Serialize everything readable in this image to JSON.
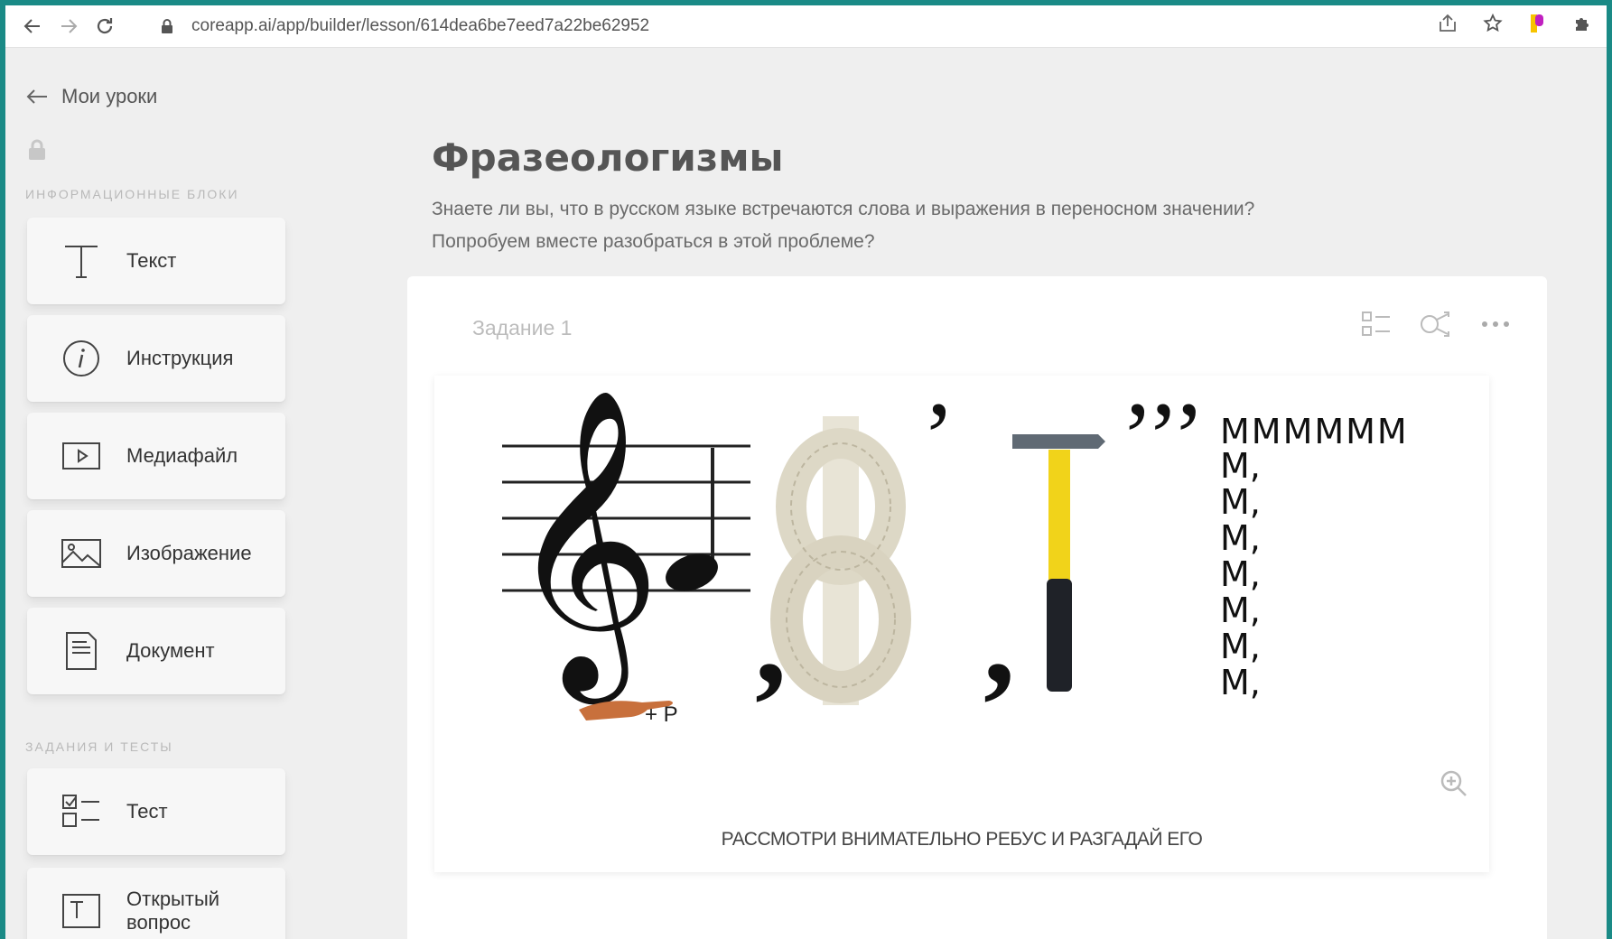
{
  "browser": {
    "url": "coreapp.ai/app/builder/lesson/614dea6be7eed7a22be62952"
  },
  "sidebar": {
    "back_label": "Мои уроки",
    "info_section_title": "ИНФОРМАЦИОННЫЕ БЛОКИ",
    "info_items": [
      {
        "label": "Текст",
        "icon": "text-t-icon"
      },
      {
        "label": "Инструкция",
        "icon": "info-icon"
      },
      {
        "label": "Медиафайл",
        "icon": "media-play-icon"
      },
      {
        "label": "Изображение",
        "icon": "image-icon"
      },
      {
        "label": "Документ",
        "icon": "document-icon"
      }
    ],
    "tasks_section_title": "ЗАДАНИЯ И ТЕСТЫ",
    "task_items": [
      {
        "label": "Тест",
        "icon": "checklist-icon"
      },
      {
        "label_line1": "Открытый",
        "label_line2": "вопрос",
        "icon": "open-question-icon"
      }
    ]
  },
  "lesson": {
    "title": "Фразеологизмы",
    "desc_line1": "Знаете ли вы, что в русском языке встречаются слова и выражения в переносном значении?",
    "desc_line2": "Попробуем вместе разобраться в этой проблеме?"
  },
  "task": {
    "label": "Задание 1",
    "rebus_pointer_text": "+ Р",
    "rebus_m_row": "ММММММ",
    "rebus_m_col": "М,",
    "caption": "РАССМОТРИ ВНИМАТЕЛЬНО РЕБУС И РАЗГАДАЙ ЕГО"
  }
}
